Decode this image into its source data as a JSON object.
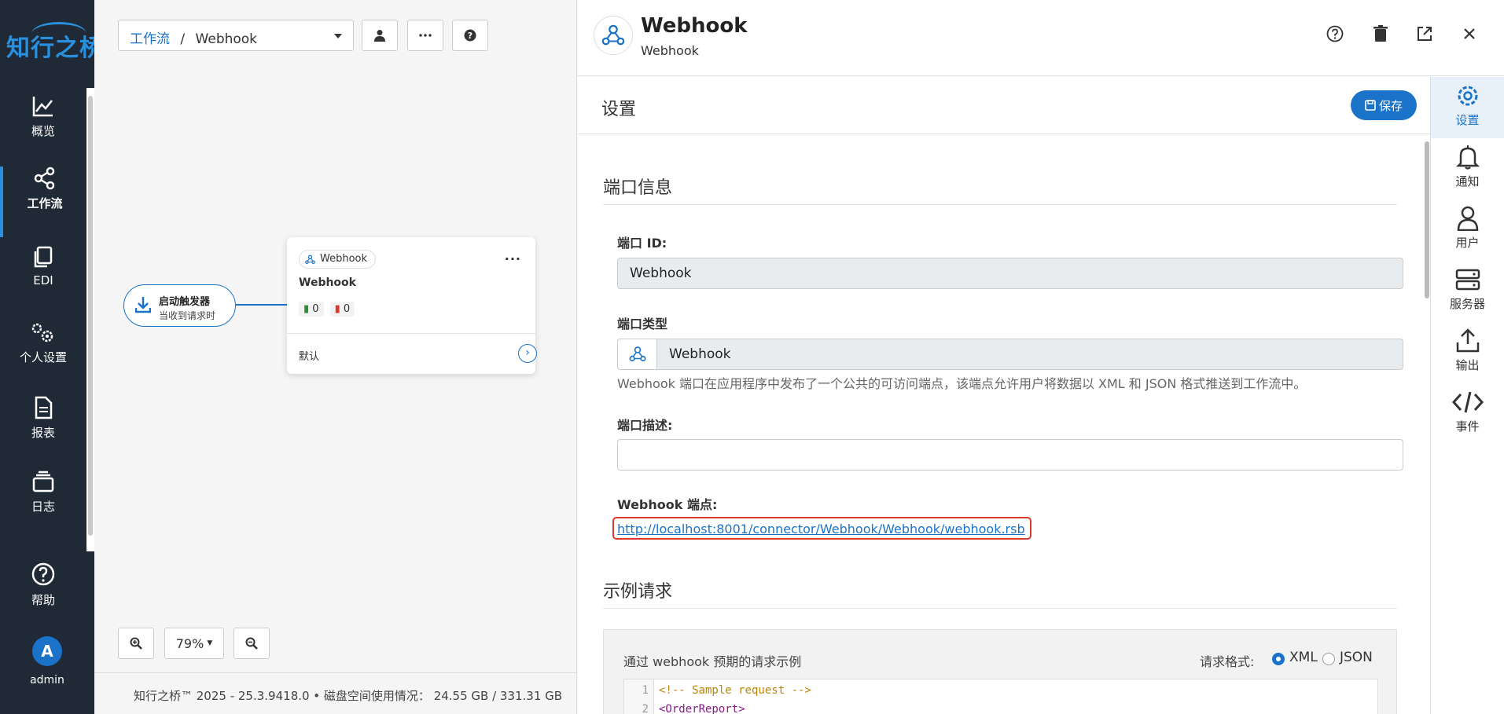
{
  "nav": {
    "logo": "知行之桥",
    "items": [
      {
        "label": "概览",
        "icon": "chart-line-icon"
      },
      {
        "label": "工作流",
        "icon": "share-nodes-icon"
      },
      {
        "label": "EDI",
        "icon": "copy-icon"
      },
      {
        "label": "个人设置",
        "icon": "gears-icon"
      },
      {
        "label": "报表",
        "icon": "file-text-icon"
      },
      {
        "label": "日志",
        "icon": "layers-icon"
      },
      {
        "label": "帮助",
        "icon": "help-circle-icon"
      }
    ],
    "avatar_letter": "A",
    "user": "admin"
  },
  "canvas": {
    "breadcrumb_root": "工作流",
    "breadcrumb_sep": "/",
    "breadcrumb_current": "Webhook",
    "trigger": {
      "title": "启动触发器",
      "subtitle": "当收到请求时"
    },
    "node": {
      "chip": "Webhook",
      "title": "Webhook",
      "success_count": "0",
      "error_count": "0",
      "default_label": "默认"
    },
    "zoom": "79%",
    "footer": "知行之桥™ 2025 - 25.3.9418.0  •  磁盘空间使用情况： 24.55 GB / 331.31 GB"
  },
  "panel": {
    "title": "Webhook",
    "subtitle": "Webhook",
    "settings_title": "设置",
    "save_label": "保存",
    "port_info_title": "端口信息",
    "port_id_label": "端口 ID:",
    "port_id_value": "Webhook",
    "port_type_label": "端口类型",
    "port_type_value": "Webhook",
    "port_type_help": "Webhook 端口在应用程序中发布了一个公共的可访问端点，该端点允许用户将数据以 XML 和 JSON 格式推送到工作流中。",
    "port_desc_label": "端口描述:",
    "port_desc_value": "",
    "endpoint_label": "Webhook 端点:",
    "endpoint_url": "http://localhost:8001/connector/Webhook/Webhook/webhook.rsb",
    "example_title": "示例请求",
    "example_desc": "通过 webhook 预期的请求示例",
    "format_label": "请求格式:",
    "format_xml": "XML",
    "format_json": "JSON",
    "format_selected": "XML",
    "code_lines": [
      "<!-- Sample request -->",
      "<OrderReport>"
    ],
    "code_line_numbers": [
      "1",
      "2"
    ]
  },
  "rail": {
    "items": [
      {
        "label": "设置",
        "icon": "gear-icon"
      },
      {
        "label": "通知",
        "icon": "bell-icon"
      },
      {
        "label": "用户",
        "icon": "user-icon"
      },
      {
        "label": "服务器",
        "icon": "server-icon"
      },
      {
        "label": "输出",
        "icon": "upload-icon"
      },
      {
        "label": "事件",
        "icon": "code-icon"
      }
    ],
    "active": "设置"
  },
  "colors": {
    "accent": "#1a73c8",
    "nav_bg": "#1f2a36",
    "highlight_border": "#d93a2b"
  }
}
